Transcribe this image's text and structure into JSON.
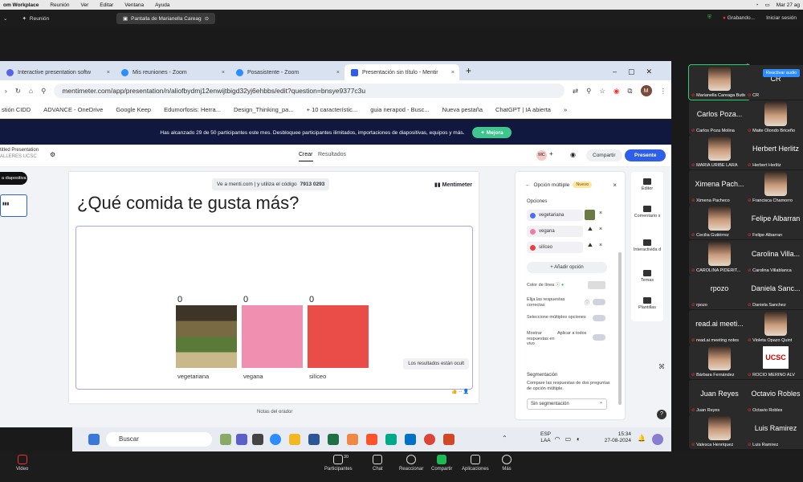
{
  "mac_menubar": {
    "app": "om Workplace",
    "items": [
      "Reunión",
      "Ver",
      "Editar",
      "Ventana",
      "Ayuda"
    ],
    "date": "Mar 27 ag"
  },
  "zoom_top": {
    "meeting": "Reunión",
    "share_label": "Pantalla de Marianella Careag",
    "recording": "Grabando...",
    "signin": "Iniciar sesión"
  },
  "browser": {
    "tabs": [
      {
        "label": "Interactive presentation softw"
      },
      {
        "label": "Mis reuniones - Zoom"
      },
      {
        "label": "Posasistente - Zoom"
      },
      {
        "label": "Presentación sin título - Mentir"
      }
    ],
    "url": "mentimeter.com/app/presentation/n/aliofbydmj12enwijtbigd32yj6ehbbs/edit?question=bnsye9377c3u",
    "profile_initial": "M",
    "bookmarks": [
      "stión CIDD",
      "ADVANCE - OneDrive",
      "Google Keep",
      "Edumorfosis: Herra...",
      "Design_Thinking_pa...",
      "+ 10 característic...",
      "guia nerapod - Busc...",
      "Nueva pestaña",
      "ChatGPT | IA abierta"
    ]
  },
  "banner": {
    "text": "Has alcanzado 29 de 50 participantes este mes. Desbloquee participantes ilimitados, importaciones de diapositivas, equipos y más.",
    "button": "Mejora"
  },
  "menti": {
    "pres_title": "titled Presentation",
    "pres_sub": "ALLERES UCSC",
    "tab_create": "Crear",
    "tab_results": "Resultados",
    "avatar": "MC",
    "share": "Compartir",
    "present": "Presente",
    "new_slide": "a diapositiva",
    "slide_num": "1",
    "code_text": "Ve a menti.com | y utiliza el código",
    "code": "7913 0293",
    "logo": "Mentimeter",
    "question": "¿Qué comida te gusta más?",
    "tooltip": "Los resultados están ocult",
    "notes": "Notas del orador"
  },
  "chart_data": {
    "type": "bar",
    "categories": [
      "vegetariana",
      "vegana",
      "silíceo"
    ],
    "values": [
      0,
      0,
      0
    ],
    "colors": [
      "#6b7a45",
      "#f08fb0",
      "#ea4d48"
    ]
  },
  "edit_panel": {
    "title": "Opción múltiple",
    "badge": "Nuevo",
    "options_label": "Opciones",
    "options": [
      {
        "label": "vegetariana",
        "color": "#4e6cf0"
      },
      {
        "label": "vegana",
        "color": "#f07aa8"
      },
      {
        "label": "silíceo",
        "color": "#e9403f"
      }
    ],
    "add_option": "Añadir opción",
    "line_color": "Color de línea",
    "correct": "Elija las respuestas correctas",
    "multiple": "Seleccione múltiples opciones",
    "show_live": "Mostrar respuestas en vivo",
    "apply_all": "Aplicar a todos",
    "segmentation": "Segmentación",
    "seg_desc": "Compare las respuestas de dos preguntas de opción múltiple.",
    "seg_select": "Sin segmentación"
  },
  "right_rail": [
    "Editor",
    "Comentario s",
    "Interactivida d",
    "Temas",
    "Plantillas"
  ],
  "taskbar": {
    "search": "Buscar",
    "lang": "ESP",
    "lang2": "LAA",
    "time": "15:34",
    "date": "27-08-2024"
  },
  "gallery": {
    "reactivate_audio": "Reactivar audio",
    "tiles": [
      {
        "big": "",
        "name": "Marianella Careaga Butter"
      },
      {
        "big": "CR",
        "name": "CR"
      },
      {
        "big": "Carlos Poza...",
        "name": "Carlos Poza Molina"
      },
      {
        "big": "",
        "name": "Maite Olondo Briceño"
      },
      {
        "big": "",
        "name": "MARIA URIBE LARA"
      },
      {
        "big": "Herbert Herlitz",
        "name": "Herbert Herlitz"
      },
      {
        "big": "Ximena Pach...",
        "name": "Ximena Pacheco"
      },
      {
        "big": "",
        "name": "Francisca Chamorro"
      },
      {
        "big": "",
        "name": "Cecilia Gutiérrez"
      },
      {
        "big": "Felipe Albarran",
        "name": "Felipe Albarran"
      },
      {
        "big": "",
        "name": "CAROLINA PIDERIT..."
      },
      {
        "big": "Carolina Villa...",
        "name": "Carolina Villablanca"
      },
      {
        "big": "rpozo",
        "name": "rpozo"
      },
      {
        "big": "Daniela Sanc...",
        "name": "Daniela Sanchez"
      },
      {
        "big": "read.ai meeti...",
        "name": "read.ai meeting notes"
      },
      {
        "big": "",
        "name": "Violeta Opazo Quint"
      },
      {
        "big": "",
        "name": "Bárbara Fernández"
      },
      {
        "big": "UCSC",
        "name": "ROCIO MERINO ALV"
      },
      {
        "big": "Juan Reyes",
        "name": "Juan Reyes"
      },
      {
        "big": "Octavio Robles",
        "name": "Octavio Robles"
      },
      {
        "big": "",
        "name": "Valesca Henríquez"
      },
      {
        "big": "Luis Ramirez",
        "name": "Luis Ramirez"
      }
    ]
  },
  "zoom_bottom": {
    "video": "Video",
    "participants": "Participantes",
    "participants_count": "30",
    "chat": "Chat",
    "react": "Reaccionar",
    "share": "Compartir",
    "apps": "Aplicaciones",
    "more": "Más"
  }
}
